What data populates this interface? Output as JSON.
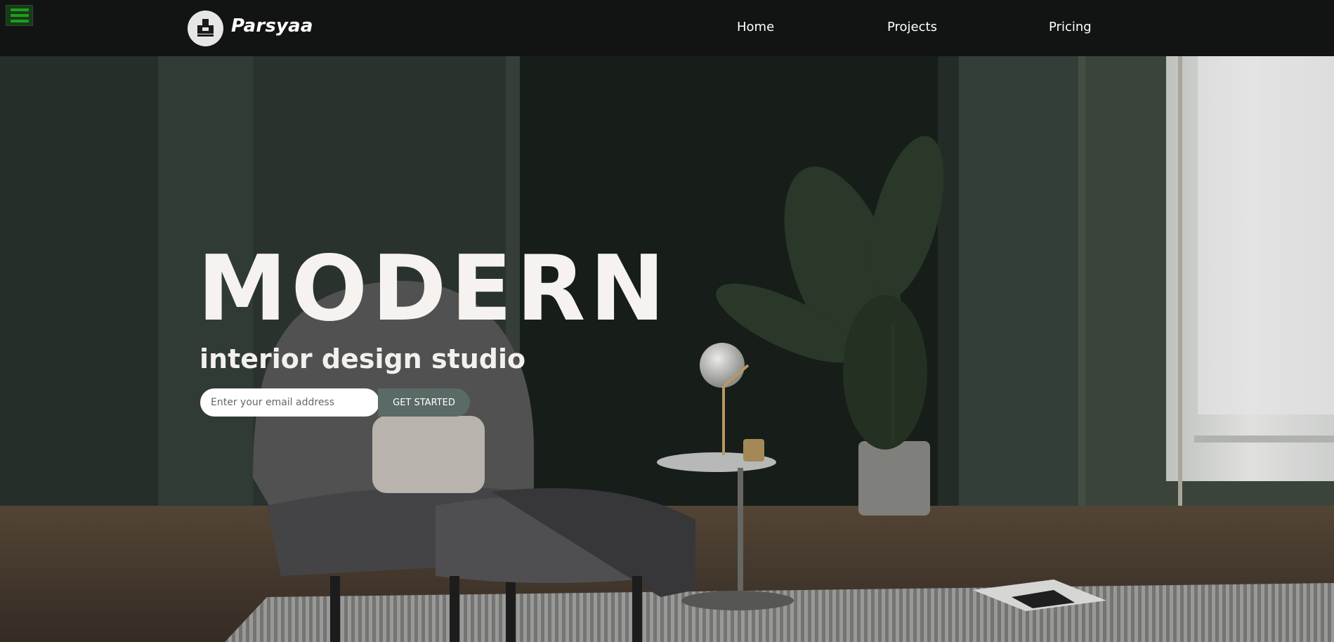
{
  "nav": {
    "menu_icon": "hamburger-icon",
    "logo_icon": "brand-logo",
    "brand_name": "Parsyaa",
    "links": [
      {
        "label": "Home"
      },
      {
        "label": "Projects"
      },
      {
        "label": "Pricing"
      }
    ]
  },
  "hero": {
    "title": "MODERN",
    "subtitle": "interior design studio",
    "email_placeholder": "Enter your email address",
    "cta_label": "GET STARTED"
  },
  "colors": {
    "navbar_bg": "#121413",
    "hamburger_accent": "#1aa01a",
    "wall": "#2f3833",
    "text_light": "#f5f2ef",
    "cta_bg": "#5a6a66"
  }
}
